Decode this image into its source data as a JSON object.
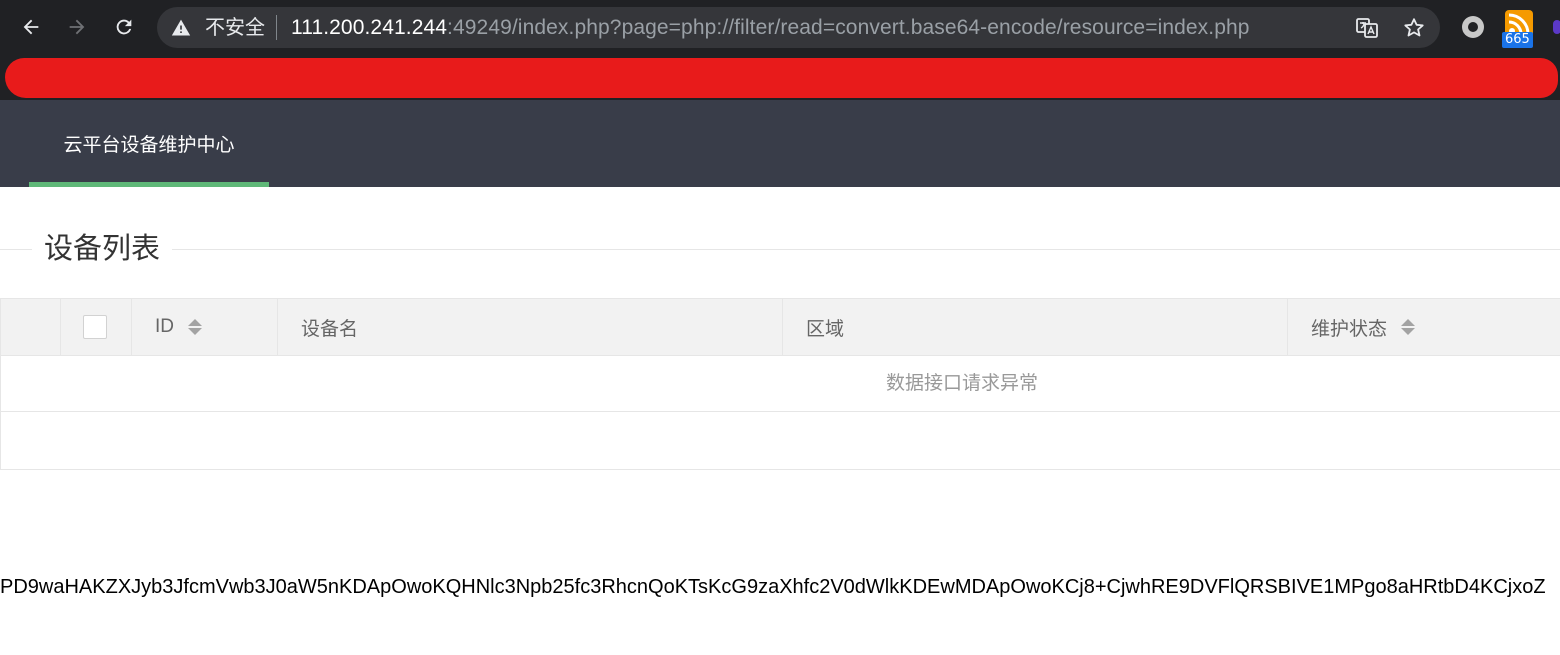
{
  "browser": {
    "security_label": "不安全",
    "url_host": "111.200.241.244",
    "url_rest": ":49249/index.php?page=php://filter/read=convert.base64-encode/resource=index.php",
    "extension_badge": "665",
    "redaction_color": "#e81b1b"
  },
  "header": {
    "title": "云平台设备维护中心",
    "accent_color": "#5fb878",
    "background_color": "#393d49"
  },
  "section": {
    "title": "设备列表"
  },
  "table": {
    "columns": {
      "id": "ID",
      "name": "设备名",
      "region": "区域",
      "status": "维护状态"
    },
    "empty_message": "数据接口请求异常"
  },
  "output": {
    "base64_text": "PD9waHAKZXJyb3JfcmVwb3J0aW5nKDApOwoKQHNlc3Npb25fc3RhcnQoKTsKcG9zaXhfc2V0dWlkKDEwMDApOwoKCj8+CjwhRE9DVFlQRSBIVE1MPgo8aHRtbD4KCjxoZ"
  }
}
